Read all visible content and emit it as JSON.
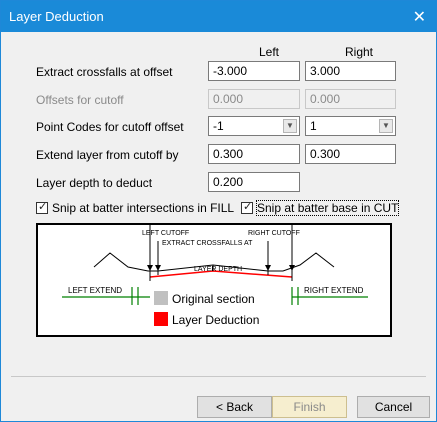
{
  "window": {
    "title": "Layer Deduction"
  },
  "columns": {
    "left": "Left",
    "right": "Right"
  },
  "rows": {
    "extract_label": "Extract crossfalls at offset",
    "extract_left": "-3.000",
    "extract_right": "3.000",
    "offsets_label": "Offsets for cutoff",
    "offsets_left": "0.000",
    "offsets_right": "0.000",
    "codes_label": "Point Codes for cutoff offset",
    "codes_left": "-1",
    "codes_right": "1",
    "extend_label": "Extend layer from cutoff by",
    "extend_left": "0.300",
    "extend_right": "0.300",
    "depth_label": "Layer depth to deduct",
    "depth_value": "0.200"
  },
  "checks": {
    "fill_label": "Snip at batter intersections in FILL",
    "fill_checked": true,
    "cut_label": "Snip at batter base in CUT",
    "cut_checked": true
  },
  "diagram": {
    "left_cutoff": "LEFT CUTOFF",
    "right_cutoff": "RIGHT CUTOFF",
    "extract": "EXTRACT CROSSFALLS AT",
    "layer_depth": "LAYER DEPTH",
    "left_extend": "LEFT EXTEND",
    "right_extend": "RIGHT EXTEND",
    "legend_original": "Original section",
    "legend_deduction": "Layer Deduction",
    "color_original": "#c0c0c0",
    "color_deduction": "#ff0000",
    "color_extend": "#008000"
  },
  "buttons": {
    "back": "< Back",
    "finish": "Finish",
    "cancel": "Cancel"
  }
}
